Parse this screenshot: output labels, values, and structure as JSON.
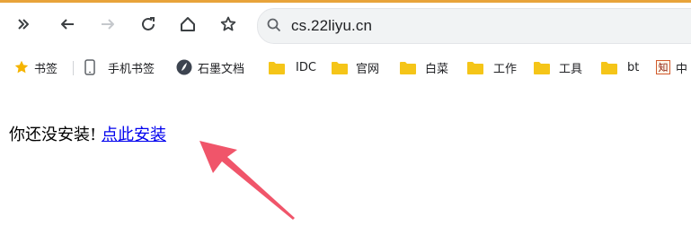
{
  "toolbar": {
    "icons": [
      "chevron-double-right-icon",
      "back-arrow-icon",
      "forward-arrow-icon",
      "reload-icon",
      "home-icon",
      "star-icon"
    ],
    "url": "cs.22liyu.cn"
  },
  "bookmarks": {
    "items": [
      {
        "label": "书签",
        "icon": "star-icon"
      },
      {
        "label": "手机书签",
        "icon": "phone-icon"
      },
      {
        "label": "石墨文档",
        "icon": "shimo-logo-icon"
      },
      {
        "label": "IDC",
        "icon": "folder-icon"
      },
      {
        "label": "官网",
        "icon": "folder-icon"
      },
      {
        "label": "白菜",
        "icon": "folder-icon"
      },
      {
        "label": "工作",
        "icon": "folder-icon"
      },
      {
        "label": "工具",
        "icon": "folder-icon"
      },
      {
        "label": "bt",
        "icon": "folder-icon"
      },
      {
        "label": "中",
        "icon": "zhi-icon"
      }
    ],
    "zhi_glyph": "知"
  },
  "content": {
    "message": "你还没安装!",
    "link_text": "点此安装"
  },
  "colors": {
    "accent_top": "#e8a33a",
    "folder": "#f5c518",
    "link": "#0000ee",
    "arrow": "#f0556a"
  }
}
